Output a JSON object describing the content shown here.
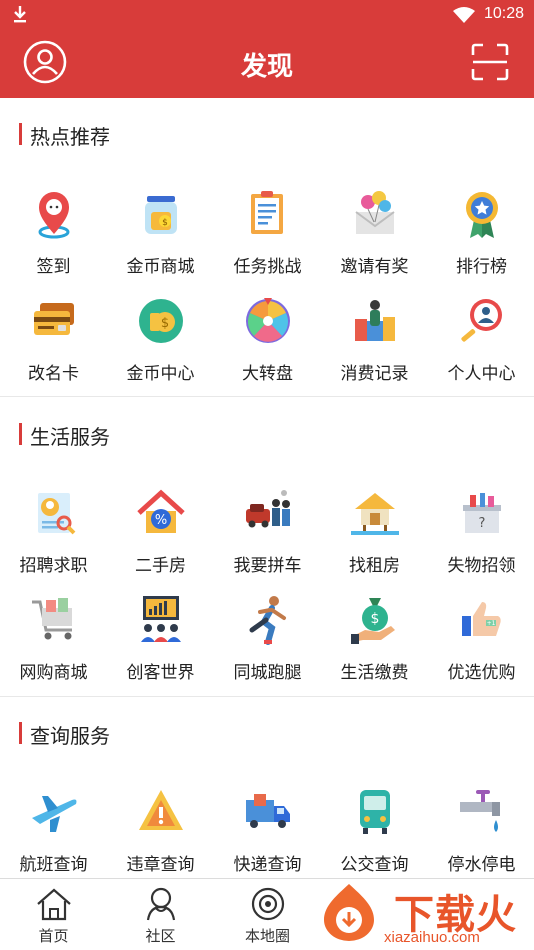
{
  "status_bar": {
    "time": "10:28"
  },
  "header": {
    "title": "发现"
  },
  "sections": [
    {
      "title": "热点推荐",
      "items": [
        {
          "label": "签到",
          "icon": "location-pin-icon"
        },
        {
          "label": "金币商城",
          "icon": "coin-jar-icon"
        },
        {
          "label": "任务挑战",
          "icon": "clipboard-icon"
        },
        {
          "label": "邀请有奖",
          "icon": "balloon-envelope-icon"
        },
        {
          "label": "排行榜",
          "icon": "medal-icon"
        },
        {
          "label": "改名卡",
          "icon": "card-icon"
        },
        {
          "label": "金币中心",
          "icon": "coin-icon"
        },
        {
          "label": "大转盘",
          "icon": "wheel-icon"
        },
        {
          "label": "消费记录",
          "icon": "shopping-bags-icon"
        },
        {
          "label": "个人中心",
          "icon": "user-search-icon"
        }
      ]
    },
    {
      "title": "生活服务",
      "items": [
        {
          "label": "招聘求职",
          "icon": "resume-icon"
        },
        {
          "label": "二手房",
          "icon": "house-percent-icon"
        },
        {
          "label": "我要拼车",
          "icon": "carpool-icon"
        },
        {
          "label": "找租房",
          "icon": "hut-icon"
        },
        {
          "label": "失物招领",
          "icon": "lost-box-icon"
        },
        {
          "label": "网购商城",
          "icon": "shopping-cart-icon"
        },
        {
          "label": "创客世界",
          "icon": "presentation-icon"
        },
        {
          "label": "同城跑腿",
          "icon": "runner-icon"
        },
        {
          "label": "生活缴费",
          "icon": "money-bag-icon"
        },
        {
          "label": "优选优购",
          "icon": "thumbs-up-icon"
        }
      ]
    },
    {
      "title": "查询服务",
      "items": [
        {
          "label": "航班查询",
          "icon": "airplane-icon"
        },
        {
          "label": "违章查询",
          "icon": "warning-icon"
        },
        {
          "label": "快递查询",
          "icon": "delivery-truck-icon"
        },
        {
          "label": "公交查询",
          "icon": "bus-icon"
        },
        {
          "label": "停水停电",
          "icon": "water-tap-icon"
        }
      ]
    }
  ],
  "tabbar": [
    {
      "label": "首页",
      "icon": "home-icon"
    },
    {
      "label": "社区",
      "icon": "community-icon"
    },
    {
      "label": "本地圈",
      "icon": "local-circle-icon"
    }
  ],
  "watermark": {
    "text": "下载火",
    "url": "xiazaihuo.com"
  },
  "colors": {
    "brand": "#d83c3a",
    "watermark": "#e8552a"
  }
}
